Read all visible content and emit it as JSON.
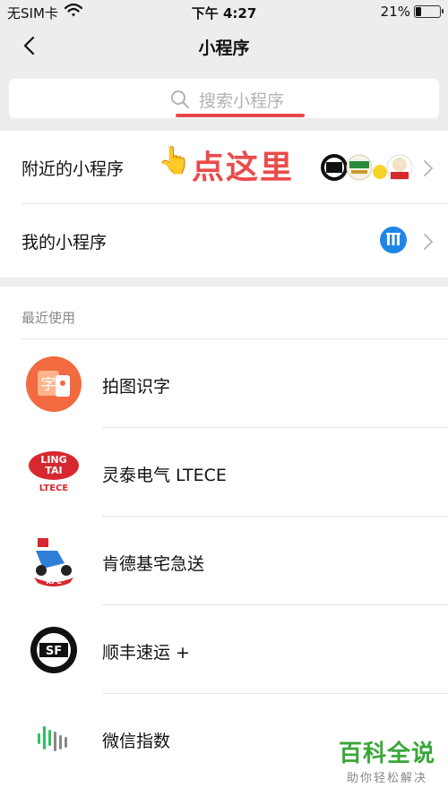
{
  "status_bar": {
    "carrier": "无SIM卡",
    "time": "下午 4:27",
    "battery": "21%",
    "battery_level": 0.21
  },
  "nav": {
    "title": "小程序"
  },
  "search": {
    "placeholder": "搜索小程序"
  },
  "menu": {
    "nearby_label": "附近的小程序",
    "hint_text": "点这里",
    "my_label": "我的小程序"
  },
  "recent": {
    "heading": "最近使用",
    "items": [
      {
        "name": "拍图识字",
        "icon": "photo-text-icon"
      },
      {
        "name": "灵泰电气 LTECE",
        "icon": "lingtai-logo"
      },
      {
        "name": "肯德基宅急送",
        "icon": "kfc-delivery-logo"
      },
      {
        "name": "顺丰速运 +",
        "icon": "sf-express-logo"
      },
      {
        "name": "微信指数",
        "icon": "wechat-index-logo"
      }
    ]
  },
  "watermark": {
    "title": "百科全说",
    "subtitle": "助你轻松解决"
  }
}
